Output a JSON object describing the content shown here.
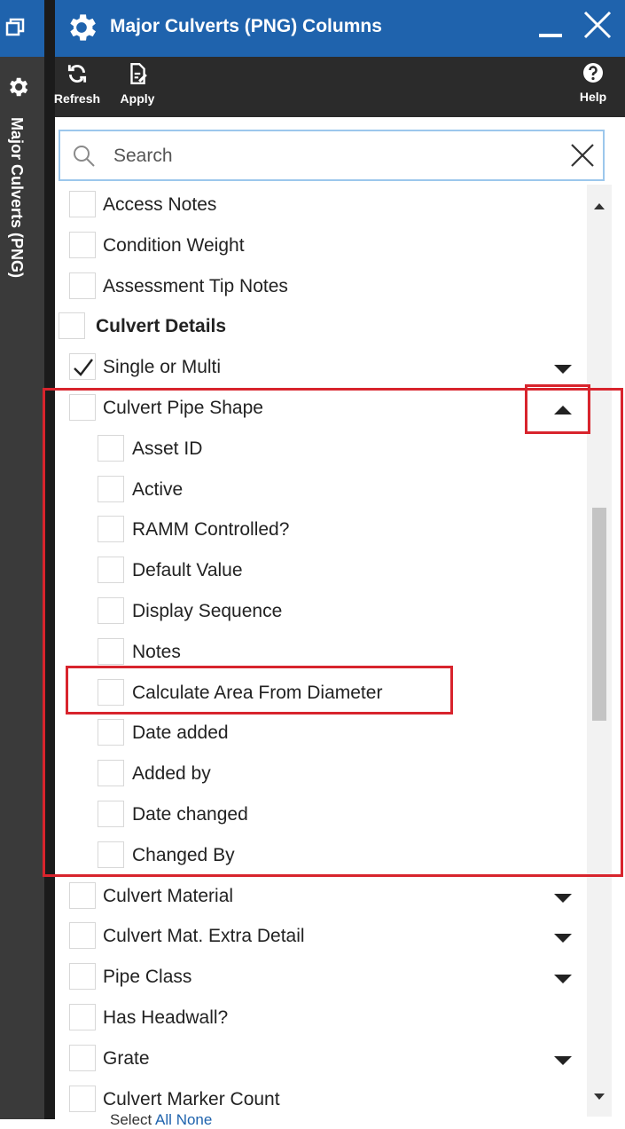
{
  "window": {
    "title": "Major Culverts (PNG) Columns",
    "side_label": "Major Culverts (PNG)"
  },
  "toolbar": {
    "refresh_label": "Refresh",
    "apply_label": "Apply",
    "help_label": "Help"
  },
  "search": {
    "placeholder": "Search",
    "value": ""
  },
  "columns": [
    {
      "label": "Access Notes",
      "checked": false,
      "level": 1
    },
    {
      "label": "Condition Weight",
      "checked": false,
      "level": 1
    },
    {
      "label": "Assessment Tip Notes",
      "checked": false,
      "level": 1
    },
    {
      "label": "Culvert Details",
      "checked": false,
      "level": 0,
      "bold": true
    },
    {
      "label": "Single or Multi",
      "checked": true,
      "level": 1,
      "expander": "collapsed"
    },
    {
      "label": "Culvert Pipe Shape",
      "checked": false,
      "level": 1,
      "expander": "expanded"
    },
    {
      "label": "Asset ID",
      "checked": false,
      "level": 2
    },
    {
      "label": "Active",
      "checked": false,
      "level": 2
    },
    {
      "label": "RAMM Controlled?",
      "checked": false,
      "level": 2
    },
    {
      "label": "Default Value",
      "checked": false,
      "level": 2
    },
    {
      "label": "Display Sequence",
      "checked": false,
      "level": 2
    },
    {
      "label": "Notes",
      "checked": false,
      "level": 2
    },
    {
      "label": "Calculate Area From Diameter",
      "checked": false,
      "level": 2
    },
    {
      "label": "Date added",
      "checked": false,
      "level": 2
    },
    {
      "label": "Added by",
      "checked": false,
      "level": 2
    },
    {
      "label": "Date changed",
      "checked": false,
      "level": 2
    },
    {
      "label": "Changed By",
      "checked": false,
      "level": 2
    },
    {
      "label": "Culvert Material",
      "checked": false,
      "level": 1,
      "expander": "collapsed"
    },
    {
      "label": "Culvert Mat. Extra Detail",
      "checked": false,
      "level": 1,
      "expander": "collapsed"
    },
    {
      "label": "Pipe Class",
      "checked": false,
      "level": 1,
      "expander": "collapsed"
    },
    {
      "label": "Has Headwall?",
      "checked": false,
      "level": 1
    },
    {
      "label": "Grate",
      "checked": false,
      "level": 1,
      "expander": "collapsed"
    },
    {
      "label": "Culvert Marker Count",
      "checked": false,
      "level": 1
    }
  ],
  "footer": {
    "select_label": "Select",
    "all_label": "All",
    "none_label": "None"
  },
  "colors": {
    "title_bar": "#1f63ad",
    "toolbar": "#2b2b2b",
    "highlight": "#d8242d"
  }
}
